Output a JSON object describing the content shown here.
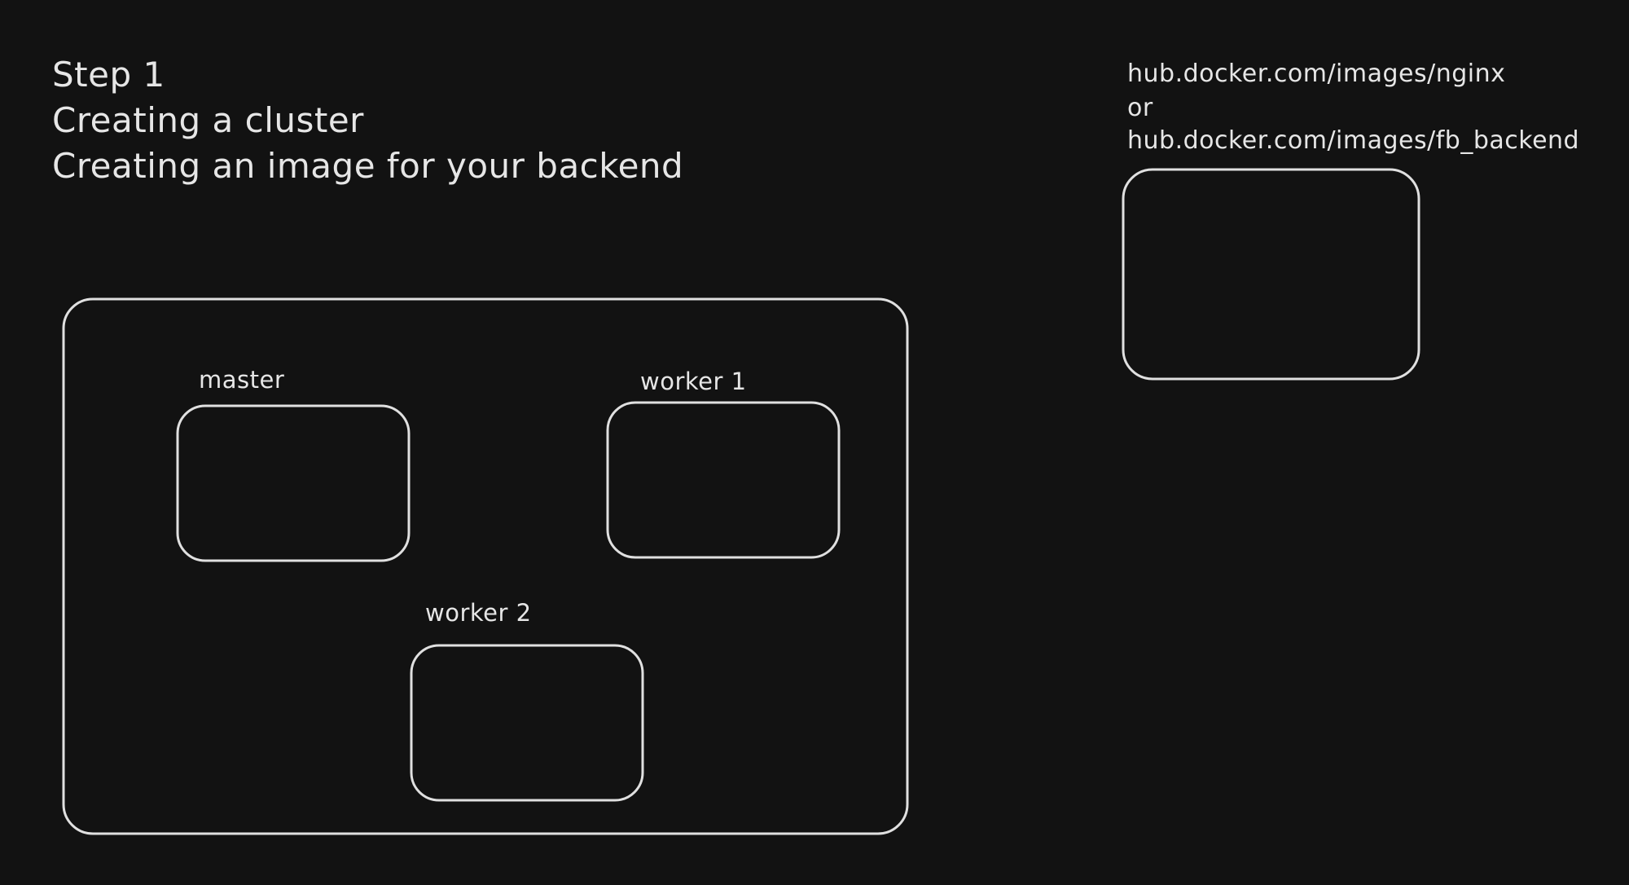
{
  "heading": {
    "lines": [
      "Step 1",
      "Creating a cluster",
      "Creating an image for your backend"
    ]
  },
  "image_source": {
    "lines": [
      "hub.docker.com/images/nginx",
      "or",
      "hub.docker.com/images/fb_backend"
    ]
  },
  "cluster": {
    "nodes": [
      {
        "label": "master"
      },
      {
        "label": "worker 1"
      },
      {
        "label": "worker 2"
      }
    ]
  }
}
